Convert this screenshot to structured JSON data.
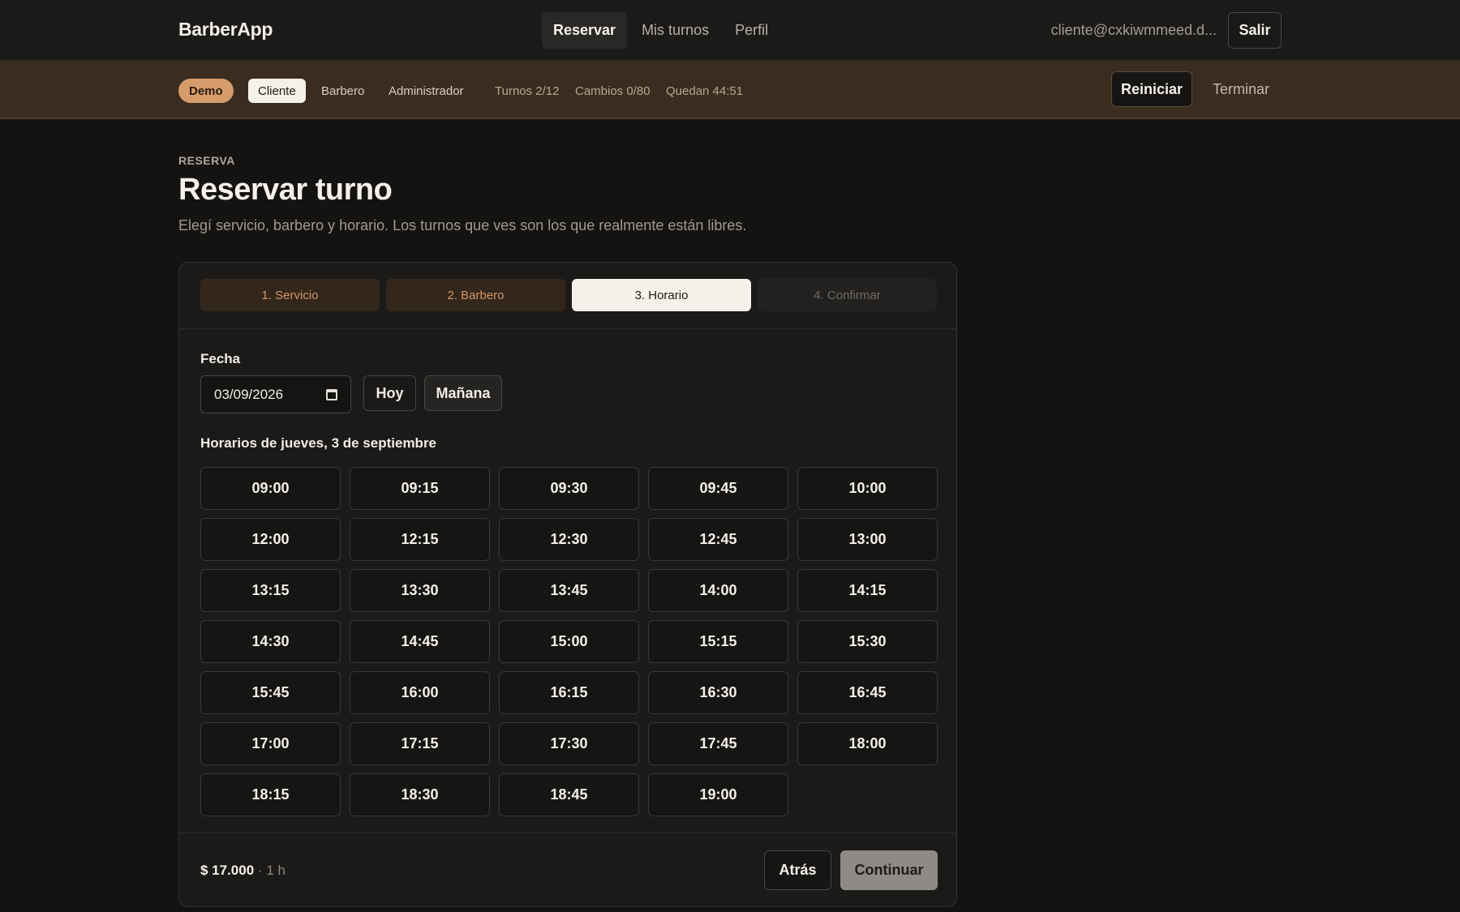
{
  "header": {
    "brand": "BarberApp",
    "nav": [
      {
        "label": "Reservar",
        "active": true
      },
      {
        "label": "Mis turnos",
        "active": false
      },
      {
        "label": "Perfil",
        "active": false
      }
    ],
    "user_email": "cliente@cxkiwmmeed.d...",
    "logout_label": "Salir"
  },
  "demo_bar": {
    "badge": "Demo",
    "roles": [
      {
        "label": "Cliente",
        "active": true
      },
      {
        "label": "Barbero",
        "active": false
      },
      {
        "label": "Administrador",
        "active": false
      }
    ],
    "stats": {
      "turnos": "Turnos 2/12",
      "cambios": "Cambios 0/80",
      "quedan": "Quedan 44:51"
    },
    "reset_label": "Reiniciar",
    "end_label": "Terminar"
  },
  "page": {
    "eyebrow": "RESERVA",
    "title": "Reservar turno",
    "subtitle": "Elegí servicio, barbero y horario. Los turnos que ves son los que realmente están libres."
  },
  "booking": {
    "steps": [
      {
        "label": "1. Servicio",
        "state": "done"
      },
      {
        "label": "2. Barbero",
        "state": "done"
      },
      {
        "label": "3. Horario",
        "state": "current"
      },
      {
        "label": "4. Confirmar",
        "state": "todo"
      }
    ],
    "date_label": "Fecha",
    "date_value": "03/09/2026",
    "today_label": "Hoy",
    "tomorrow_label": "Mañana",
    "slots_heading": "Horarios de jueves, 3 de septiembre",
    "slots": [
      "09:00",
      "09:15",
      "09:30",
      "09:45",
      "10:00",
      "12:00",
      "12:15",
      "12:30",
      "12:45",
      "13:00",
      "13:15",
      "13:30",
      "13:45",
      "14:00",
      "14:15",
      "14:30",
      "14:45",
      "15:00",
      "15:15",
      "15:30",
      "15:45",
      "16:00",
      "16:15",
      "16:30",
      "16:45",
      "17:00",
      "17:15",
      "17:30",
      "17:45",
      "18:00",
      "18:15",
      "18:30",
      "18:45",
      "19:00"
    ],
    "price": "$ 17.000",
    "separator": "·",
    "duration": "1 h",
    "back_label": "Atrás",
    "continue_label": "Continuar"
  },
  "colors": {
    "accent": "#d69c6b",
    "background": "#141312",
    "demo_bar": "#3a2d20"
  }
}
